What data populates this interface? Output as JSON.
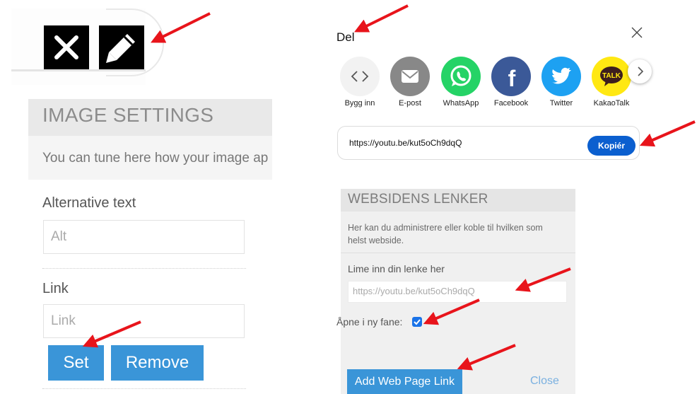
{
  "toolbar": {
    "close_icon": "x-icon",
    "edit_icon": "pencil-icon"
  },
  "image_settings": {
    "title": "IMAGE SETTINGS",
    "description": "You can tune here how your image ap",
    "alt_label": "Alternative text",
    "alt_placeholder": "Alt",
    "link_label": "Link",
    "link_placeholder": "Link",
    "set_label": "Set",
    "remove_label": "Remove"
  },
  "share": {
    "title": "Del",
    "apps": [
      {
        "label": "Bygg inn",
        "icon": "embed-icon",
        "color": "#f2f2f2"
      },
      {
        "label": "E-post",
        "icon": "envelope-icon",
        "color": "#888888"
      },
      {
        "label": "WhatsApp",
        "icon": "whatsapp-icon",
        "color": "#25d366"
      },
      {
        "label": "Facebook",
        "icon": "facebook-icon",
        "color": "#3b5998"
      },
      {
        "label": "Twitter",
        "icon": "twitter-icon",
        "color": "#1da1f2"
      },
      {
        "label": "KakaoTalk",
        "icon": "kakaotalk-icon",
        "color": "#ffe812"
      }
    ],
    "kakao_text": "TALK",
    "url": "https://youtu.be/kut5oCh9dqQ",
    "copy_label": "Kopiér"
  },
  "web_links": {
    "title": "WEBSIDENS LENKER",
    "description": "Her kan du administrere eller koble til hvilken som helst webside.",
    "paste_label": "Lime inn din lenke her",
    "paste_value": "https://youtu.be/kut5oCh9dqQ",
    "new_tab_label": "Åpne i ny fane:",
    "new_tab_checked": true,
    "add_label": "Add Web Page Link",
    "close_label": "Close"
  },
  "annotation_color": "#e8141b"
}
